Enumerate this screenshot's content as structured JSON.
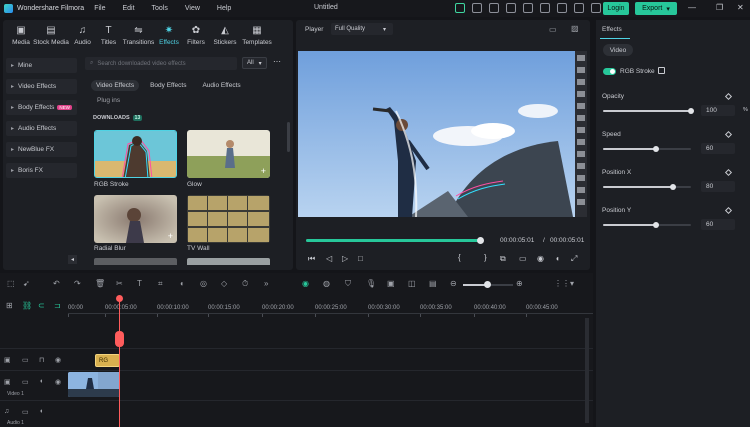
{
  "app": {
    "name": "Wondershare Filmora",
    "document_title": "Untitled",
    "menu": [
      "File",
      "Edit",
      "Tools",
      "View",
      "Help"
    ],
    "login_label": "Login",
    "export_label": "Export"
  },
  "toolbar_tabs": [
    {
      "label": "Media",
      "icon": "media-icon"
    },
    {
      "label": "Stock Media",
      "icon": "stock-media-icon"
    },
    {
      "label": "Audio",
      "icon": "audio-icon"
    },
    {
      "label": "Titles",
      "icon": "titles-icon"
    },
    {
      "label": "Transitions",
      "icon": "transitions-icon"
    },
    {
      "label": "Effects",
      "icon": "effects-icon",
      "active": true
    },
    {
      "label": "Filters",
      "icon": "filters-icon"
    },
    {
      "label": "Stickers",
      "icon": "stickers-icon"
    },
    {
      "label": "Templates",
      "icon": "templates-icon"
    }
  ],
  "sidebar": {
    "items": [
      "Mine",
      "Video Effects",
      "Body Effects",
      "Audio Effects",
      "NewBlue FX",
      "Boris FX"
    ],
    "new_badge": "NEW"
  },
  "library": {
    "search_placeholder": "Search downloaded video effects",
    "filter_value": "All",
    "subtabs": [
      "Video Effects",
      "Body Effects",
      "Audio Effects"
    ],
    "plugins_label": "Plug ins",
    "downloads_label": "DOWNLOADS",
    "downloads_count": "13",
    "effects": [
      "RGB Stroke",
      "Glow",
      "Radial Blur",
      "TV Wall"
    ]
  },
  "player": {
    "label": "Player",
    "quality": "Full Quality",
    "current_time": "00:00:05:01",
    "separator": "/",
    "total_time": "00:00:05:01",
    "progress": 0.99
  },
  "properties": {
    "tab_label": "Effects",
    "subtab_label": "Video",
    "effect_name": "RGB Stroke",
    "params": [
      {
        "label": "Opacity",
        "value": "100",
        "unit": "%",
        "level": 1.0
      },
      {
        "label": "Speed",
        "value": "60",
        "unit": "",
        "level": 0.6
      },
      {
        "label": "Position X",
        "value": "80",
        "unit": "",
        "level": 0.8
      },
      {
        "label": "Position Y",
        "value": "60",
        "unit": "",
        "level": 0.6
      }
    ]
  },
  "timeline": {
    "ruler": [
      "00:00",
      "00:00:05:00",
      "00:00:10:00",
      "00:00:15:00",
      "00:00:20:00",
      "00:00:25:00",
      "00:00:30:00",
      "00:00:35:00",
      "00:00:40:00",
      "00:00:45:00"
    ],
    "effect_clip_label": "RG",
    "tracks": [
      "Video 1",
      "Audio 1"
    ]
  },
  "colors": {
    "accent": "#27c79a",
    "active_tab": "#4fd3e4",
    "playhead": "#ff5c5c"
  }
}
